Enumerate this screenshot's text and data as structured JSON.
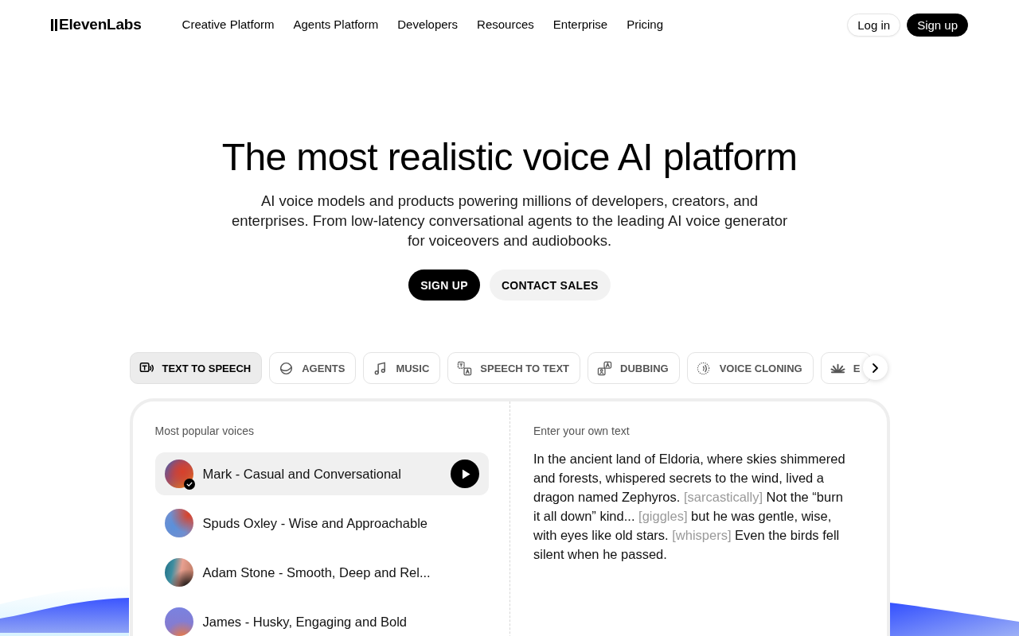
{
  "header": {
    "logo": "ElevenLabs",
    "nav": [
      "Creative Platform",
      "Agents Platform",
      "Developers",
      "Resources",
      "Enterprise",
      "Pricing"
    ],
    "login": "Log in",
    "signup": "Sign up"
  },
  "hero": {
    "title": "The most realistic voice AI platform",
    "subtitle": "AI voice models and products powering millions of developers, creators, and enterprises. From low-latency conversational agents to the leading AI voice generator for voiceovers and audiobooks.",
    "buttons": [
      {
        "label": "SIGN UP",
        "kind": "primary"
      },
      {
        "label": "CONTACT SALES",
        "kind": "secondary"
      }
    ]
  },
  "product_tabs": [
    {
      "label": "TEXT TO SPEECH",
      "selected": true
    },
    {
      "label": "AGENTS",
      "selected": false
    },
    {
      "label": "MUSIC",
      "selected": false
    },
    {
      "label": "SPEECH TO TEXT",
      "selected": false
    },
    {
      "label": "DUBBING",
      "selected": false
    },
    {
      "label": "VOICE CLONING",
      "selected": false
    },
    {
      "label": "E",
      "selected": false
    }
  ],
  "voice_panel": {
    "heading": "Most popular voices",
    "voices": [
      {
        "name": "Mark - Casual and Conversational",
        "selected": true
      },
      {
        "name": "Spuds Oxley - Wise and Approachable",
        "selected": false
      },
      {
        "name": "Adam Stone - Smooth, Deep and Rel...",
        "selected": false
      },
      {
        "name": "James - Husky, Engaging and Bold",
        "selected": false
      }
    ]
  },
  "text_panel": {
    "heading": "Enter your own text",
    "segments": [
      {
        "kind": "text",
        "text": "In the ancient land of Eldoria, where skies shimmered and forests, whispered secrets to the wind, lived a dragon named Zephyros. "
      },
      {
        "kind": "tag",
        "text": "[sarcastically]"
      },
      {
        "kind": "text",
        "text": " Not the “burn it all down” kind... "
      },
      {
        "kind": "tag",
        "text": "[giggles]"
      },
      {
        "kind": "text",
        "text": " but he was gentle, wise, with eyes like old stars. "
      },
      {
        "kind": "tag",
        "text": "[whispers]"
      },
      {
        "kind": "text",
        "text": " Even the birds fell silent when he passed."
      }
    ]
  }
}
